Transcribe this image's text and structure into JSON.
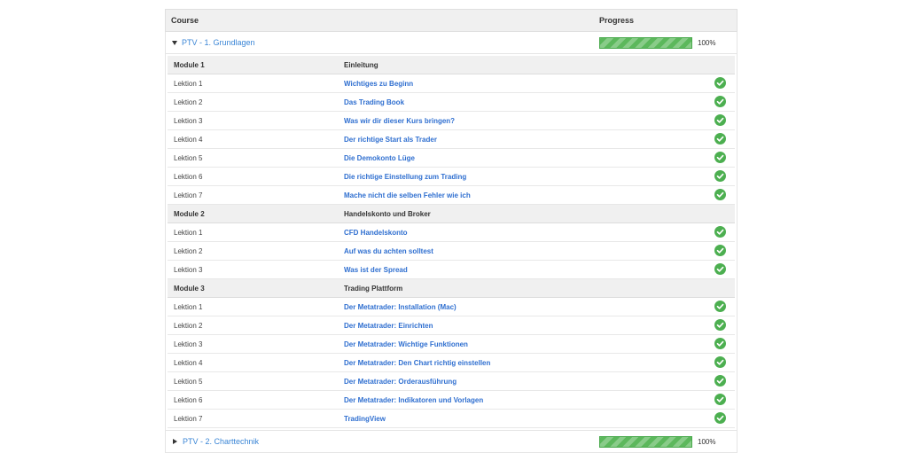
{
  "table": {
    "col_course": "Course",
    "col_progress": "Progress"
  },
  "courses": [
    {
      "title": "PTV - 1. Grundlagen",
      "progress_label": "100%",
      "progress": 100,
      "expanded": true
    },
    {
      "title": "PTV - 2. Charttechnik",
      "progress_label": "100%",
      "progress": 100,
      "expanded": false
    }
  ],
  "modules": [
    {
      "name": "Module 1",
      "title": "Einleitung",
      "lessons": [
        {
          "label": "Lektion 1",
          "title": "Wichtiges zu Beginn",
          "completed": true
        },
        {
          "label": "Lektion 2",
          "title": "Das Trading Book",
          "completed": true
        },
        {
          "label": "Lektion 3",
          "title": "Was wir dir dieser Kurs bringen?",
          "completed": true
        },
        {
          "label": "Lektion 4",
          "title": "Der richtige Start als Trader",
          "completed": true
        },
        {
          "label": "Lektion 5",
          "title": "Die Demokonto Lüge",
          "completed": true
        },
        {
          "label": "Lektion 6",
          "title": "Die richtige Einstellung zum Trading",
          "completed": true
        },
        {
          "label": "Lektion 7",
          "title": "Mache nicht die selben Fehler wie ich",
          "completed": true
        }
      ]
    },
    {
      "name": "Module 2",
      "title": "Handelskonto und Broker",
      "lessons": [
        {
          "label": "Lektion 1",
          "title": "CFD Handelskonto",
          "completed": true
        },
        {
          "label": "Lektion 2",
          "title": "Auf was du achten solltest",
          "completed": true
        },
        {
          "label": "Lektion 3",
          "title": "Was ist der Spread",
          "completed": true
        }
      ]
    },
    {
      "name": "Module 3",
      "title": "Trading Plattform",
      "lessons": [
        {
          "label": "Lektion 1",
          "title": "Der Metatrader: Installation (Mac)",
          "completed": true
        },
        {
          "label": "Lektion 2",
          "title": "Der Metatrader: Einrichten",
          "completed": true
        },
        {
          "label": "Lektion 3",
          "title": "Der Metatrader: Wichtige Funktionen",
          "completed": true
        },
        {
          "label": "Lektion 4",
          "title": "Der Metatrader: Den Chart richtig einstellen",
          "completed": true
        },
        {
          "label": "Lektion 5",
          "title": "Der Metatrader: Orderausführung",
          "completed": true
        },
        {
          "label": "Lektion 6",
          "title": "Der Metatrader: Indikatoren und Vorlagen",
          "completed": true
        },
        {
          "label": "Lektion 7",
          "title": "TradingView",
          "completed": true
        }
      ]
    }
  ],
  "colors": {
    "accent_link": "#2f6fd0",
    "progress_green": "#5cb85c",
    "check_green": "#4caf50"
  },
  "icons": {
    "expanded": "triangle-down-icon",
    "collapsed": "triangle-right-icon",
    "completed": "check-circle-icon"
  }
}
